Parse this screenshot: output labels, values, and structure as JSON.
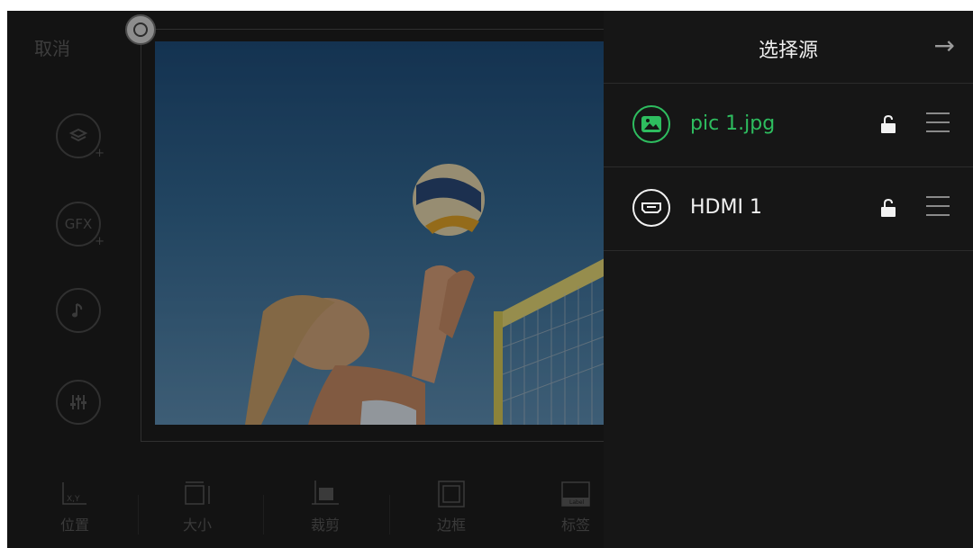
{
  "left": {
    "cancel_label": "取消",
    "side_buttons": [
      {
        "icon": "layers-add-icon"
      },
      {
        "icon": "gfx-add-icon",
        "label": "GFX"
      },
      {
        "icon": "music-note-icon"
      },
      {
        "icon": "mixer-sliders-icon"
      }
    ]
  },
  "toolbar": {
    "items": [
      {
        "label": "位置",
        "icon": "position-icon",
        "icon_text": "X,Y"
      },
      {
        "label": "大小",
        "icon": "resize-icon"
      },
      {
        "label": "裁剪",
        "icon": "crop-icon"
      },
      {
        "label": "边框",
        "icon": "border-icon"
      },
      {
        "label": "标签",
        "icon": "label-icon",
        "icon_text": "Label"
      }
    ]
  },
  "panel": {
    "title": "选择源",
    "next_icon": "arrow-right-icon",
    "sources": [
      {
        "label": "pic 1.jpg",
        "icon": "image-icon",
        "active": true,
        "color": "#2ebd5f"
      },
      {
        "label": "HDMI 1",
        "icon": "hdmi-icon",
        "active": false,
        "color": "#f2f2f2"
      }
    ]
  },
  "colors": {
    "accent_green": "#2ebd5f",
    "panel_bg": "#161616",
    "app_bg": "#1e1e1e"
  }
}
